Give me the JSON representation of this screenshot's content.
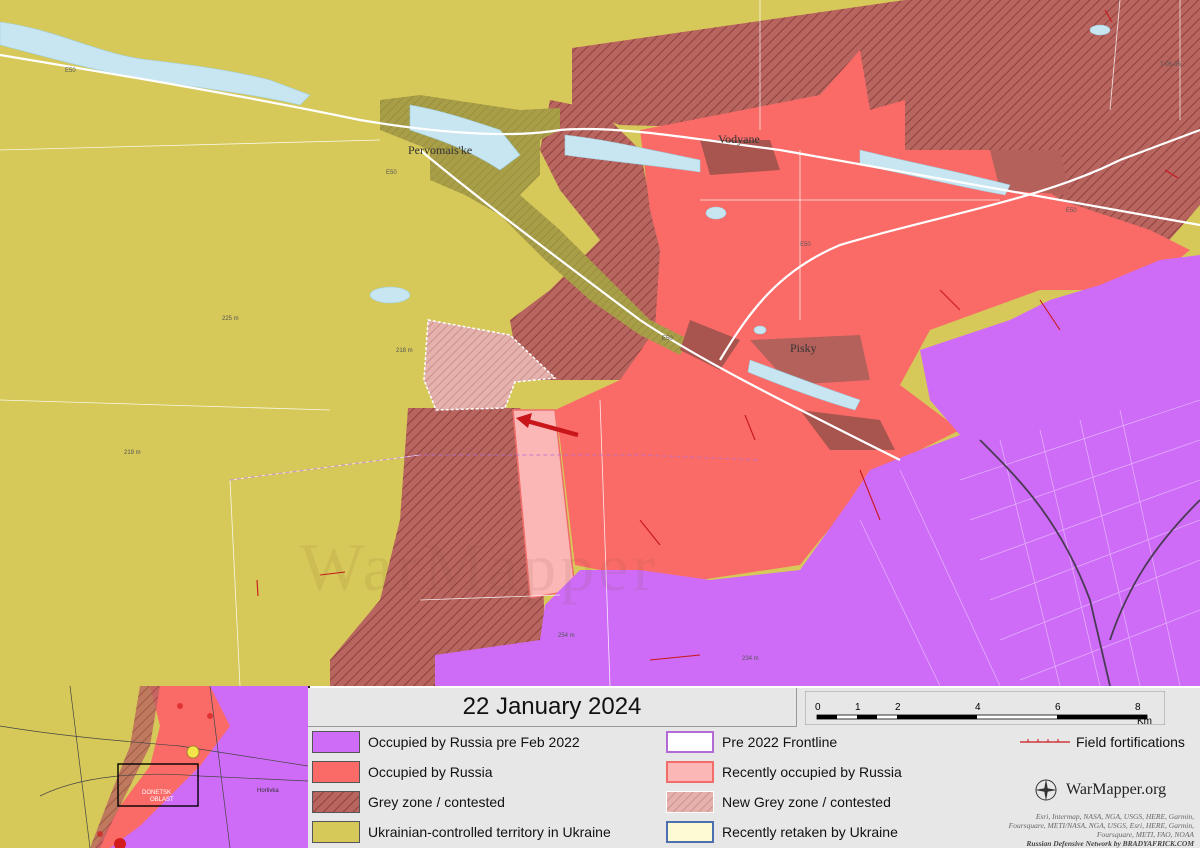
{
  "map": {
    "date_title": "22 January 2024",
    "places": [
      {
        "name": "Pervomais'ke"
      },
      {
        "name": "Vodyane"
      },
      {
        "name": "Pisky"
      }
    ],
    "road_labels": [
      "E50",
      "E50",
      "E50",
      "E50",
      "E50",
      "T-05-05"
    ],
    "elevation_labels": [
      "225 m",
      "218 m",
      "219 m",
      "254 m",
      "234 m"
    ],
    "watermark": "WarMapper"
  },
  "legend": {
    "items": [
      {
        "label": "Occupied by Russia pre Feb 2022",
        "color": "#cf6cf7",
        "style": "fill"
      },
      {
        "label": "Occupied by Russia",
        "color": "#fa6b68",
        "style": "fill"
      },
      {
        "label": "Grey zone / contested",
        "color": "#a8544f",
        "style": "hatch"
      },
      {
        "label": "Ukrainian-controlled territory in Ukraine",
        "color": "#d6c959",
        "style": "fill"
      },
      {
        "label": "Pre 2022 Frontline",
        "color": "#b46ad6",
        "style": "outline"
      },
      {
        "label": "Recently occupied by Russia",
        "color": "#fbb7b6",
        "style": "fill"
      },
      {
        "label": "New Grey zone / contested",
        "color": "#e6a6a3",
        "style": "hatch"
      },
      {
        "label": "Recently retaken by Ukraine",
        "color": "#fdfbd3",
        "style": "fill"
      }
    ],
    "field_fortifications_label": "Field fortifications",
    "scale": {
      "ticks": [
        "0",
        "1",
        "2",
        "4",
        "6",
        "8"
      ],
      "unit": "Km"
    },
    "brand": "WarMapper.org",
    "credits": [
      "Esri, Intermap, NASA, NGA, USGS, HERE, Garmin,",
      "Foursquare, METI/NASA, NGA, USGS, Esri, HERE, Garmin, Foursquare, METI, FAO, NOAA",
      "Russian Defensive Network by BRADYAFRICK.COM"
    ]
  },
  "inset": {
    "label_line1": "DONETSK",
    "label_line2": "OBLAST",
    "town": "Horlivka"
  },
  "colors": {
    "ukraine": "#d6c959",
    "occupied": "#fa6b68",
    "pre2022": "#cf6cf7",
    "grey": "#a8544f",
    "recent": "#fbb7b6",
    "river": "#c7e6f2",
    "arrow": "#c8161b"
  }
}
